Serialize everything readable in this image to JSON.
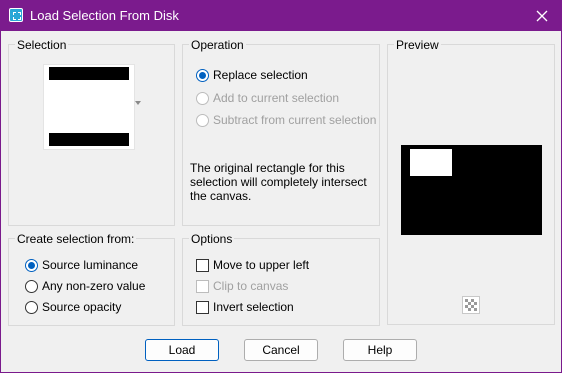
{
  "window": {
    "title": "Load Selection From Disk"
  },
  "selection_group": {
    "label": "Selection"
  },
  "operation_group": {
    "label": "Operation",
    "options": [
      {
        "label": "Replace selection",
        "checked": true,
        "enabled": true
      },
      {
        "label": "Add to current selection",
        "checked": false,
        "enabled": false
      },
      {
        "label": "Subtract from current selection",
        "checked": false,
        "enabled": false
      }
    ],
    "info_text": "The original rectangle for this selection will completely intersect the canvas."
  },
  "preview_group": {
    "label": "Preview"
  },
  "create_from_group": {
    "label": "Create selection from:",
    "options": [
      {
        "label": "Source luminance",
        "checked": true
      },
      {
        "label": "Any non-zero value",
        "checked": false
      },
      {
        "label": "Source opacity",
        "checked": false
      }
    ]
  },
  "options_group": {
    "label": "Options",
    "checkboxes": [
      {
        "label": "Move to upper left",
        "checked": false,
        "enabled": true
      },
      {
        "label": "Clip to canvas",
        "checked": false,
        "enabled": false
      },
      {
        "label": "Invert selection",
        "checked": false,
        "enabled": true
      }
    ]
  },
  "buttons": {
    "load": "Load",
    "cancel": "Cancel",
    "help": "Help"
  },
  "icons": {
    "app": "selection-app-icon",
    "close": "close-icon",
    "zoom": "checkerboard-zoom-icon"
  },
  "colors": {
    "titlebar": "#7b1b8d",
    "accent": "#0060c0",
    "background": "#f0f0f0"
  }
}
